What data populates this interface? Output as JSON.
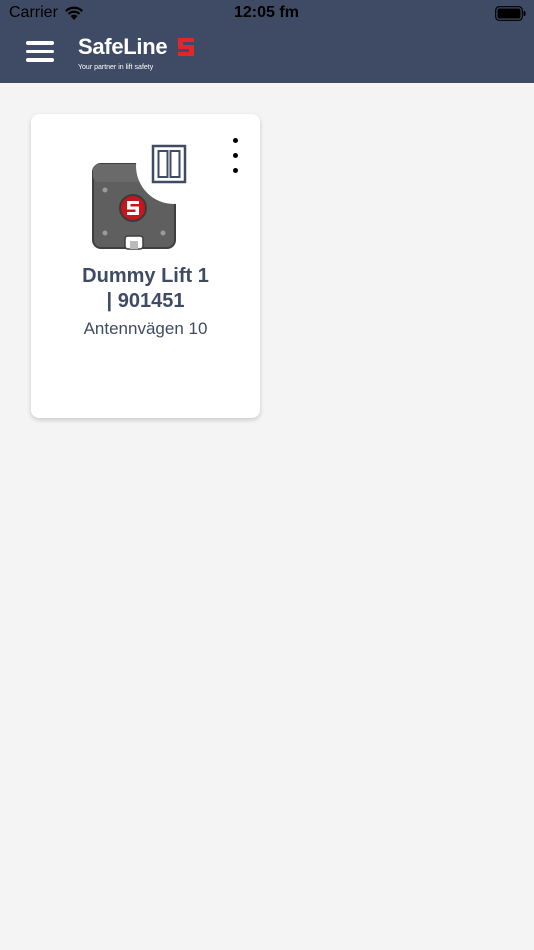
{
  "status_bar": {
    "carrier": "Carrier",
    "time": "12:05 fm"
  },
  "header": {
    "brand_name": "SafeLine",
    "tagline": "Your partner in lift safety",
    "background_color": "#3f4b64",
    "brand_accent_color": "#e3262b",
    "menu_icon": "hamburger-menu-icon"
  },
  "lifts": [
    {
      "name_line1": "Dummy Lift 1",
      "name_line2": "| 901451",
      "address": "Antennvägen 10",
      "icons": [
        "safeline-device-icon",
        "elevator-door-icon",
        "more-vertical-icon"
      ]
    }
  ]
}
